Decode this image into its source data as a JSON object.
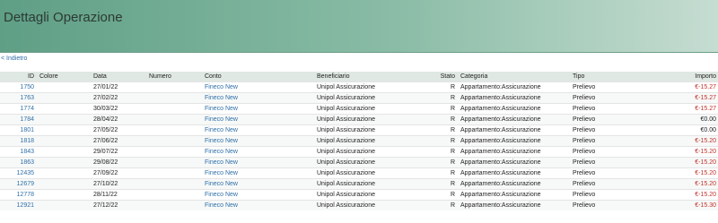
{
  "header": {
    "title": "Dettagli Operazione"
  },
  "nav": {
    "back_label": "< Indietro"
  },
  "table": {
    "columns": {
      "id": "ID",
      "colore": "Colore",
      "data": "Data",
      "numero": "Numero",
      "conto": "Conto",
      "beneficiario": "Beneficiario",
      "stato": "Stato",
      "categoria": "Categoria",
      "tipo": "Tipo",
      "importo": "Importo"
    },
    "rows": [
      {
        "id": "1750",
        "colore": "",
        "data": "27/01/22",
        "numero": "",
        "conto": "Fineco New",
        "beneficiario": "Unipol Assicurazione",
        "stato": "R",
        "categoria": "Appartamento:Assicurazione",
        "tipo": "Prelievo",
        "importo": "€-15.27"
      },
      {
        "id": "1763",
        "colore": "",
        "data": "27/02/22",
        "numero": "",
        "conto": "Fineco New",
        "beneficiario": "Unipol Assicurazione",
        "stato": "R",
        "categoria": "Appartamento:Assicurazione",
        "tipo": "Prelievo",
        "importo": "€-15.27"
      },
      {
        "id": "1774",
        "colore": "",
        "data": "30/03/22",
        "numero": "",
        "conto": "Fineco New",
        "beneficiario": "Unipol Assicurazione",
        "stato": "R",
        "categoria": "Appartamento:Assicurazione",
        "tipo": "Prelievo",
        "importo": "€-15.27"
      },
      {
        "id": "1784",
        "colore": "",
        "data": "28/04/22",
        "numero": "",
        "conto": "Fineco New",
        "beneficiario": "Unipol Assicurazione",
        "stato": "R",
        "categoria": "Appartamento:Assicurazione",
        "tipo": "Prelievo",
        "importo": "€0.00"
      },
      {
        "id": "1801",
        "colore": "",
        "data": "27/05/22",
        "numero": "",
        "conto": "Fineco New",
        "beneficiario": "Unipol Assicurazione",
        "stato": "R",
        "categoria": "Appartamento:Assicurazione",
        "tipo": "Prelievo",
        "importo": "€0.00"
      },
      {
        "id": "1818",
        "colore": "",
        "data": "27/06/22",
        "numero": "",
        "conto": "Fineco New",
        "beneficiario": "Unipol Assicurazione",
        "stato": "R",
        "categoria": "Appartamento:Assicurazione",
        "tipo": "Prelievo",
        "importo": "€-15.20"
      },
      {
        "id": "1843",
        "colore": "",
        "data": "29/07/22",
        "numero": "",
        "conto": "Fineco New",
        "beneficiario": "Unipol Assicurazione",
        "stato": "R",
        "categoria": "Appartamento:Assicurazione",
        "tipo": "Prelievo",
        "importo": "€-15.20"
      },
      {
        "id": "1863",
        "colore": "",
        "data": "29/08/22",
        "numero": "",
        "conto": "Fineco New",
        "beneficiario": "Unipol Assicurazione",
        "stato": "R",
        "categoria": "Appartamento:Assicurazione",
        "tipo": "Prelievo",
        "importo": "€-15.20"
      },
      {
        "id": "12435",
        "colore": "",
        "data": "27/09/22",
        "numero": "",
        "conto": "Fineco New",
        "beneficiario": "Unipol Assicurazione",
        "stato": "R",
        "categoria": "Appartamento:Assicurazione",
        "tipo": "Prelievo",
        "importo": "€-15.20"
      },
      {
        "id": "12679",
        "colore": "",
        "data": "27/10/22",
        "numero": "",
        "conto": "Fineco New",
        "beneficiario": "Unipol Assicurazione",
        "stato": "R",
        "categoria": "Appartamento:Assicurazione",
        "tipo": "Prelievo",
        "importo": "€-15.20"
      },
      {
        "id": "12778",
        "colore": "",
        "data": "28/11/22",
        "numero": "",
        "conto": "Fineco New",
        "beneficiario": "Unipol Assicurazione",
        "stato": "R",
        "categoria": "Appartamento:Assicurazione",
        "tipo": "Prelievo",
        "importo": "€-15.20"
      },
      {
        "id": "12921",
        "colore": "",
        "data": "27/12/22",
        "numero": "",
        "conto": "Fineco New",
        "beneficiario": "Unipol Assicurazione",
        "stato": "R",
        "categoria": "Appartamento:Assicurazione",
        "tipo": "Prelievo",
        "importo": "€-15.30"
      }
    ]
  }
}
